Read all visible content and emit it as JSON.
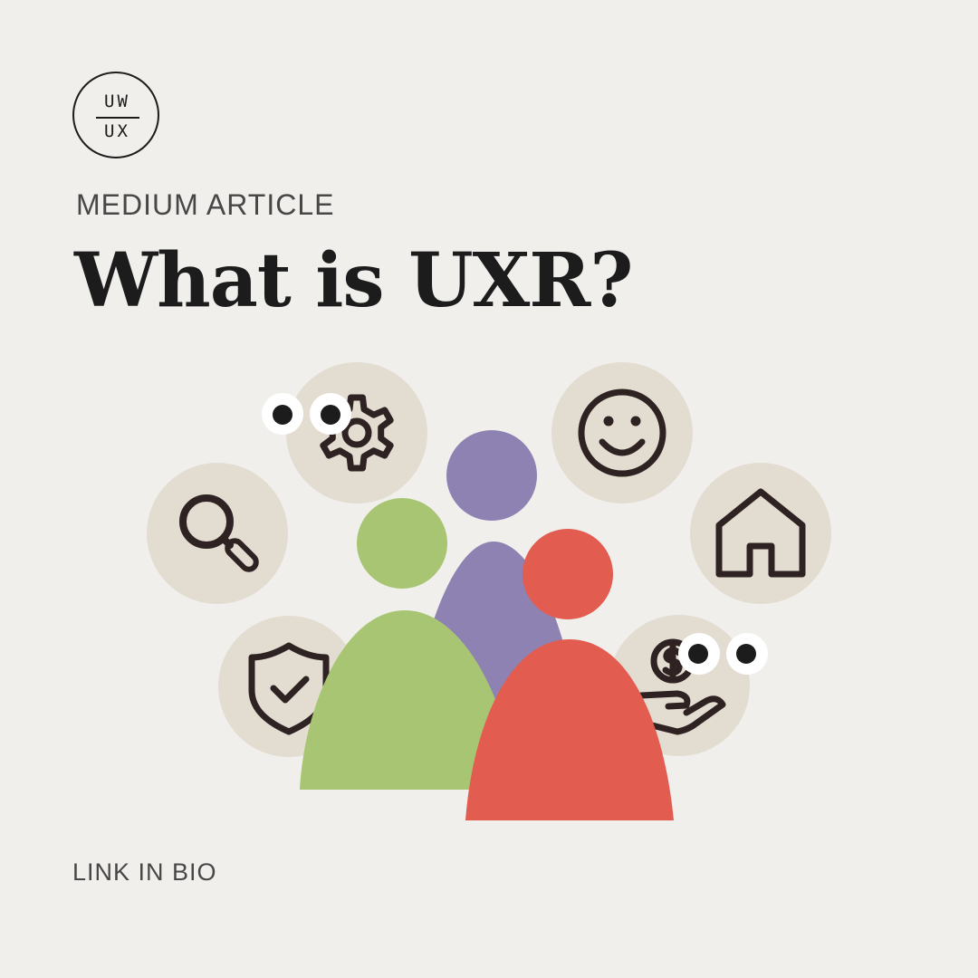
{
  "logo": {
    "top": "UW",
    "bottom": "UX"
  },
  "eyebrow": "MEDIUM ARTICLE",
  "title": "What is UXR?",
  "footer": "LINK IN BIO",
  "colors": {
    "background": "#f0efec",
    "bubble": "#e3dcd0",
    "icon_stroke": "#2e2322",
    "person_green": "#a8c573",
    "person_purple": "#8e82b2",
    "person_red": "#e25c50"
  },
  "icons": [
    "search-icon",
    "gear-icon",
    "shield-check-icon",
    "smiley-icon",
    "home-icon",
    "money-hand-icon"
  ]
}
